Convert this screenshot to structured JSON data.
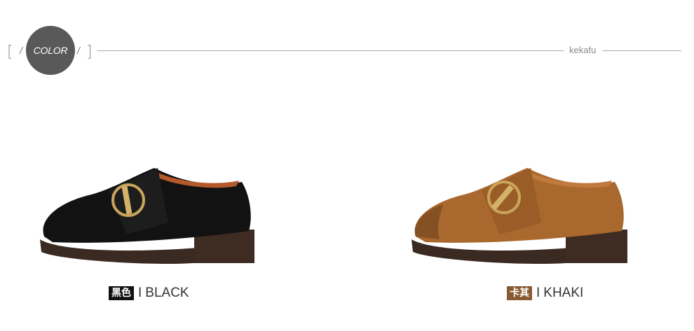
{
  "header": {
    "color_label": "COLOR",
    "brand": "kekafu"
  },
  "products": [
    {
      "cn": "黑色",
      "en": "BLACK",
      "badge_color": "#111111"
    },
    {
      "cn": "卡其",
      "en": "KHAKI",
      "badge_color": "#8a5a32"
    }
  ]
}
